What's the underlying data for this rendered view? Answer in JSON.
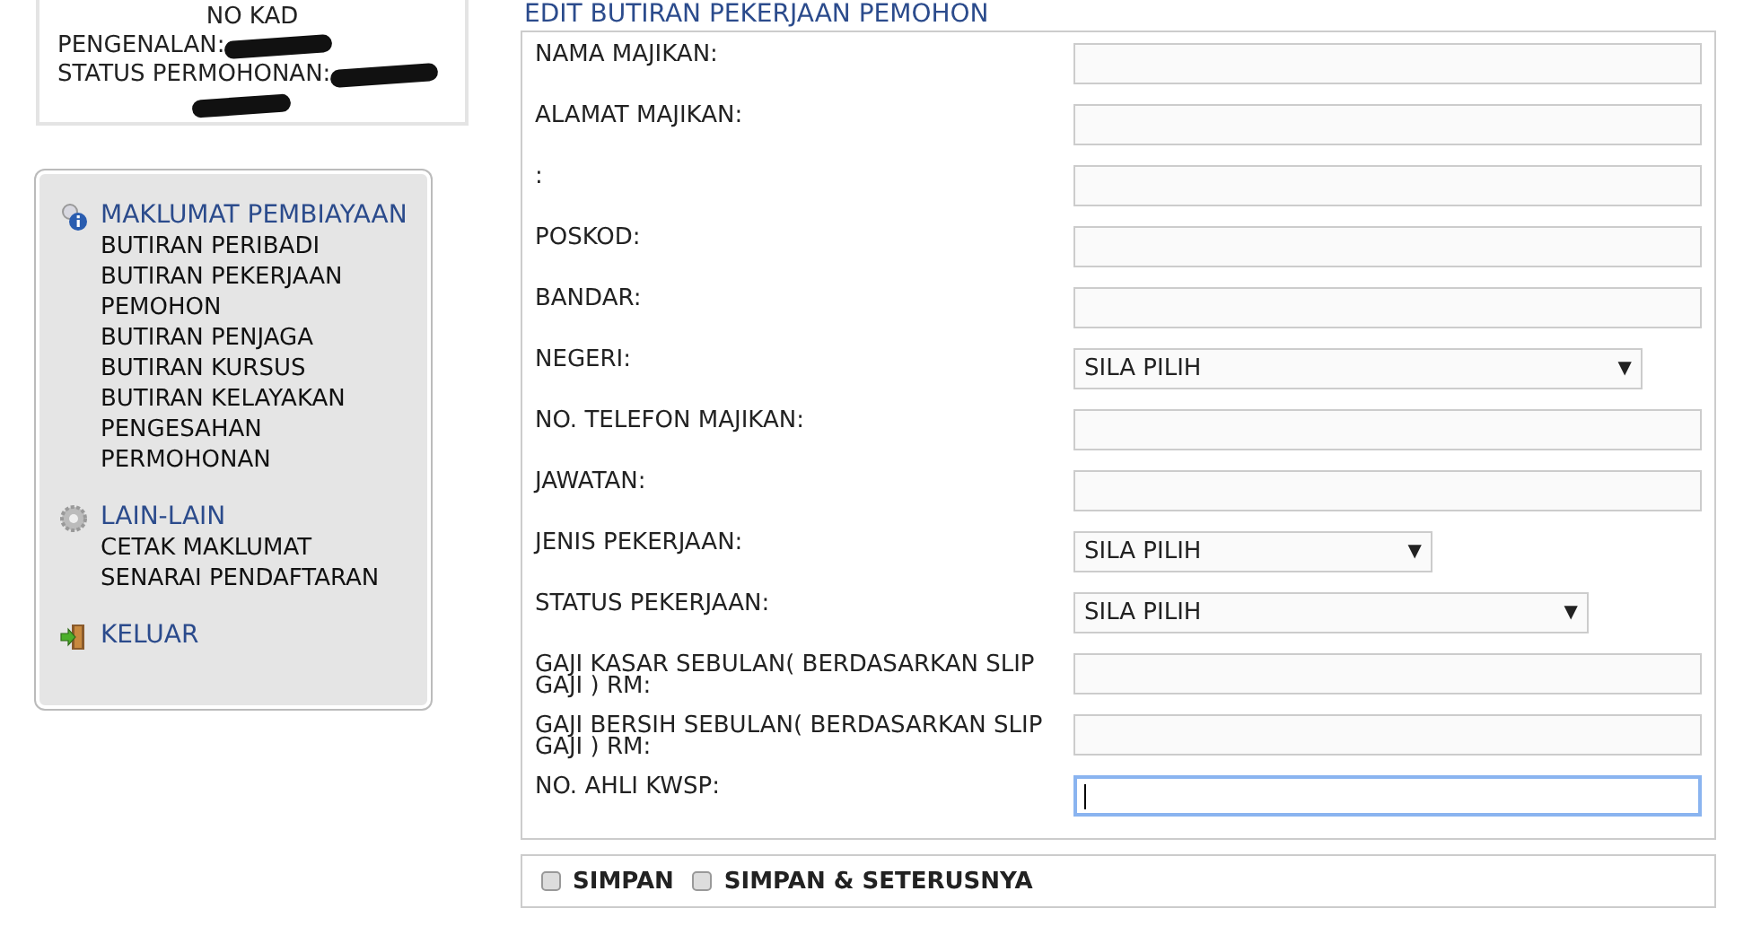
{
  "applicant_box": {
    "heading": "NO KAD",
    "lines": [
      {
        "label": "PENGENALAN:",
        "redacted": true
      },
      {
        "label": "STATUS PERMOHONAN:",
        "redacted": true
      }
    ],
    "trailing_redacted": true
  },
  "menu": [
    {
      "title": "MAKLUMAT PEMBIAYAAN",
      "items": [
        "BUTIRAN PERIBADI",
        "BUTIRAN PEKERJAAN PEMOHON",
        "BUTIRAN PENJAGA",
        "BUTIRAN KURSUS",
        "BUTIRAN KELAYAKAN",
        "PENGESAHAN PERMOHONAN"
      ]
    },
    {
      "title": "LAIN-LAIN",
      "items": [
        "CETAK MAKLUMAT",
        "SENARAI PENDAFTARAN"
      ]
    },
    {
      "title": "KELUAR"
    }
  ],
  "form": {
    "title": "EDIT BUTIRAN PEKERJAAN PEMOHON",
    "fields": [
      {
        "label": "NAMA MAJIKAN:",
        "kind": "text",
        "focused": false
      },
      {
        "label": "ALAMAT MAJIKAN:",
        "kind": "text",
        "focused": false
      },
      {
        "label": ":",
        "kind": "text",
        "focused": false
      },
      {
        "label": "POSKOD:",
        "kind": "text",
        "focused": false
      },
      {
        "label": "BANDAR:",
        "kind": "text",
        "focused": false
      },
      {
        "label": "NEGERI:",
        "kind": "select",
        "value": "SILA PILIH",
        "arrow": "▼"
      },
      {
        "label": "NO. TELEFON MAJIKAN:",
        "kind": "text",
        "focused": false
      },
      {
        "label": "JAWATAN:",
        "kind": "text",
        "focused": false
      },
      {
        "label": "JENIS PEKERJAAN:",
        "kind": "select",
        "value": "SILA PILIH",
        "arrow": "▼"
      },
      {
        "label": "STATUS PEKERJAAN:",
        "kind": "select",
        "value": "SILA PILIH",
        "arrow": "▼"
      },
      {
        "label": "GAJI KASAR SEBULAN( BERDASARKAN SLIP GAJI ) RM:",
        "kind": "text",
        "focused": false
      },
      {
        "label": "GAJI BERSIH SEBULAN( BERDASARKAN SLIP GAJI ) RM:",
        "kind": "text",
        "focused": false
      },
      {
        "label": "NO. AHLI KWSP:",
        "kind": "text",
        "focused": true
      }
    ]
  },
  "buttons": [
    "SIMPAN",
    "SIMPAN & SETERUSNYA"
  ]
}
